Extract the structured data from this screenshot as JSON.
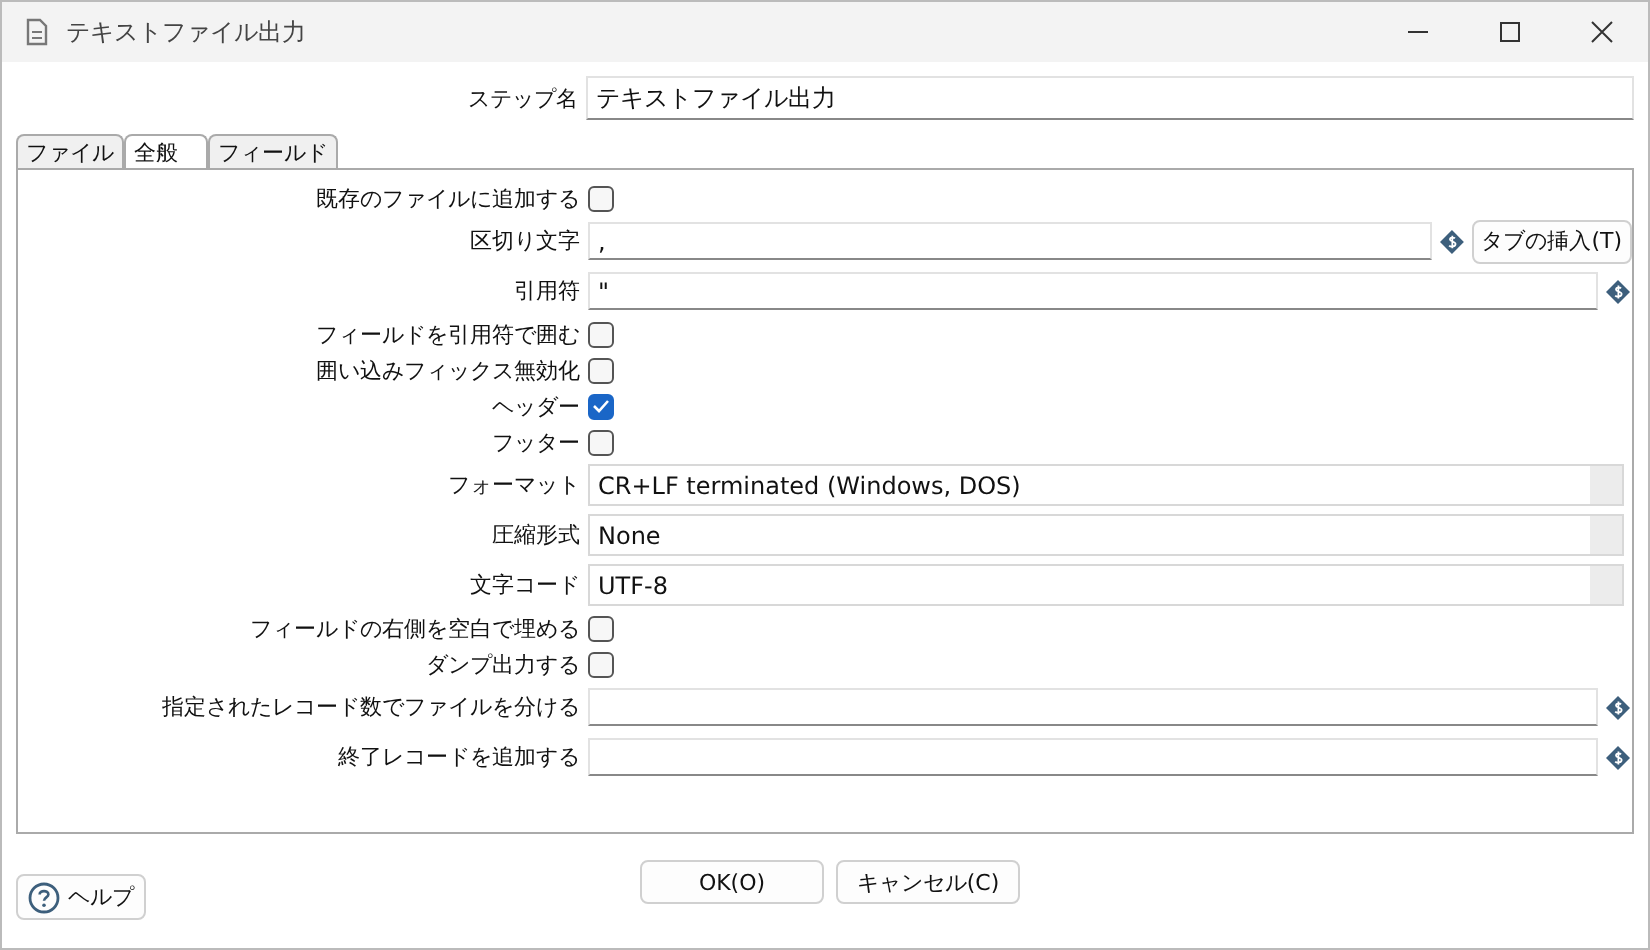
{
  "window": {
    "title": "テキストファイル出力"
  },
  "step_name": {
    "label": "ステップ名",
    "value": "テキストファイル出力"
  },
  "tabs": [
    {
      "label": "ファイル",
      "selected": false
    },
    {
      "label": "全般",
      "selected": true
    },
    {
      "label": "フィールド",
      "selected": false
    }
  ],
  "rows": [
    {
      "kind": "checkbox",
      "label": "既存のファイルに追加する",
      "checked": false
    },
    {
      "kind": "text",
      "label": "区切り文字",
      "value": ",",
      "variable": true,
      "button": "タブの挿入(T)"
    },
    {
      "kind": "text",
      "label": "引用符",
      "value": "\"",
      "variable": true
    },
    {
      "kind": "checkbox",
      "label": "フィールドを引用符で囲む",
      "checked": false
    },
    {
      "kind": "checkbox",
      "label": "囲い込みフィックス無効化",
      "checked": false
    },
    {
      "kind": "checkbox",
      "label": "ヘッダー",
      "checked": true
    },
    {
      "kind": "checkbox",
      "label": "フッター",
      "checked": false
    },
    {
      "kind": "combo",
      "label": "フォーマット",
      "value": "CR+LF terminated (Windows, DOS)"
    },
    {
      "kind": "combo",
      "label": "圧縮形式",
      "value": "None"
    },
    {
      "kind": "combo",
      "label": "文字コード",
      "value": "UTF-8"
    },
    {
      "kind": "checkbox",
      "label": "フィールドの右側を空白で埋める",
      "checked": false
    },
    {
      "kind": "checkbox",
      "label": "ダンプ出力する",
      "checked": false
    },
    {
      "kind": "text",
      "label": "指定されたレコード数でファイルを分ける",
      "variable": true
    },
    {
      "kind": "text",
      "label": "終了レコードを追加する",
      "variable": true
    }
  ],
  "buttons": {
    "ok": "OK(O)",
    "cancel": "キャンセル(C)",
    "help": "ヘルプ"
  }
}
